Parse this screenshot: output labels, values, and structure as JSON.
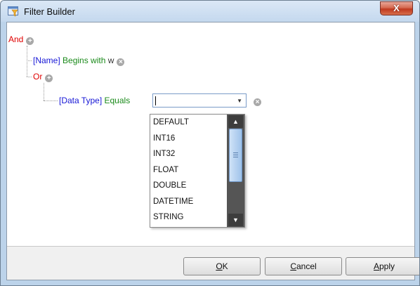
{
  "window": {
    "title": "Filter Builder",
    "close_label": "X"
  },
  "filter": {
    "root_op": "And",
    "cond1": {
      "field": "[Name]",
      "operator": "Begins with",
      "value": "w"
    },
    "group_op": "Or",
    "cond2": {
      "field": "[Data Type]",
      "operator": "Equals",
      "value": ""
    }
  },
  "dropdown": {
    "items": [
      "DEFAULT",
      "INT16",
      "INT32",
      "FLOAT",
      "DOUBLE",
      "DATETIME",
      "STRING"
    ]
  },
  "buttons": {
    "ok": {
      "mnemonic": "O",
      "rest": "K"
    },
    "cancel": {
      "mnemonic": "C",
      "rest": "ancel"
    },
    "apply": {
      "mnemonic": "A",
      "rest": "pply"
    }
  },
  "colors": {
    "group_operator": "#e00000",
    "field": "#1717d6",
    "condition_operator": "#1a8a1a"
  }
}
